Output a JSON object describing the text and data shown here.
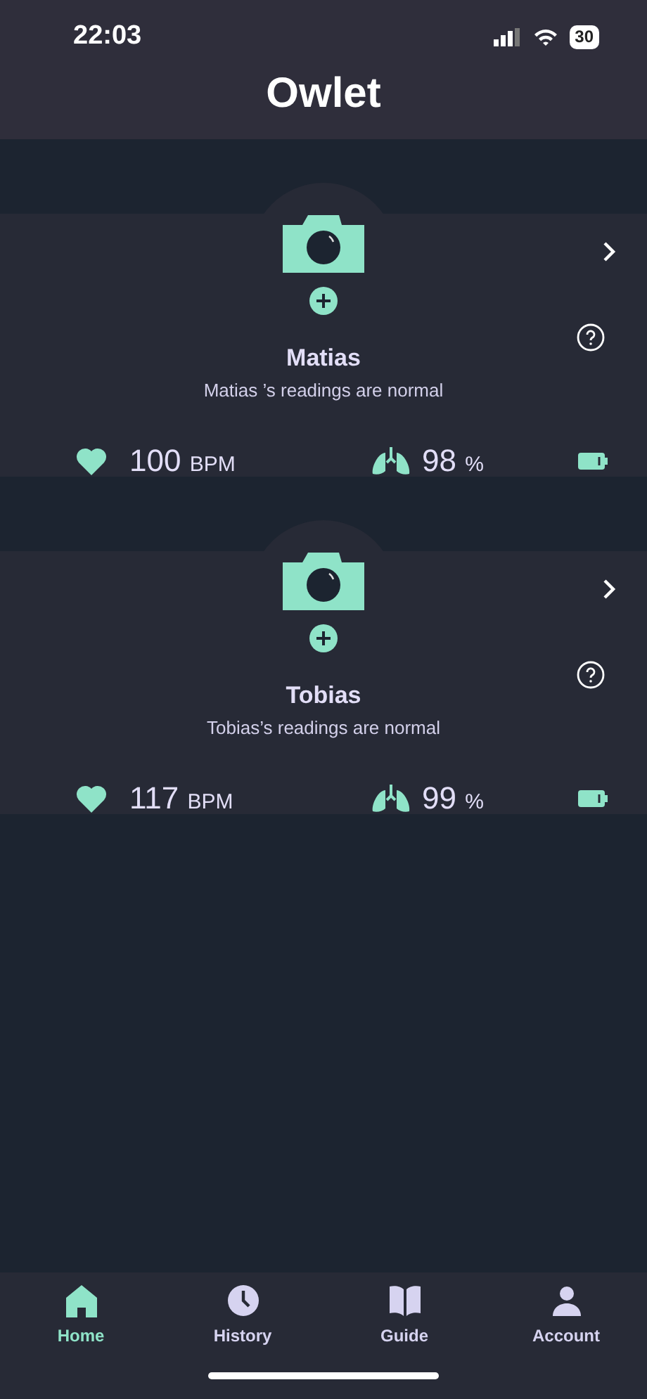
{
  "status_bar": {
    "time": "22:03",
    "battery": "30"
  },
  "header": {
    "title": "Owlet"
  },
  "babies": [
    {
      "name": "Matias",
      "status": "Matias ’s readings are normal",
      "heart_rate": "100",
      "heart_unit": "BPM",
      "oxygen": "98",
      "oxygen_unit": "%"
    },
    {
      "name": "Tobias",
      "status": "Tobias’s readings are normal",
      "heart_rate": "117",
      "heart_unit": "BPM",
      "oxygen": "99",
      "oxygen_unit": "%"
    }
  ],
  "tab_bar": [
    {
      "label": "Home",
      "kind": "home",
      "selected": true
    },
    {
      "label": "History",
      "kind": "history",
      "selected": false
    },
    {
      "label": "Guide",
      "kind": "guide",
      "selected": false
    },
    {
      "label": "Account",
      "kind": "account",
      "selected": false
    }
  ]
}
